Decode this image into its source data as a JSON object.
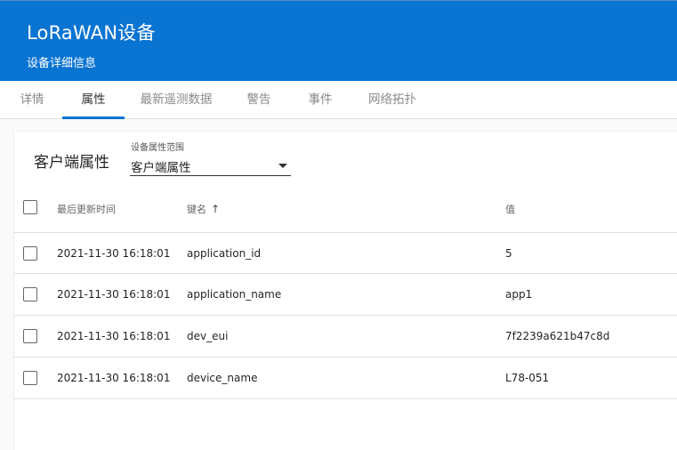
{
  "header": {
    "title": "LoRaWAN设备",
    "subtitle": "设备详细信息"
  },
  "tabs": [
    {
      "label": "详情"
    },
    {
      "label": "属性"
    },
    {
      "label": "最新遥测数据"
    },
    {
      "label": "警告"
    },
    {
      "label": "事件"
    },
    {
      "label": "网络拓扑"
    }
  ],
  "active_tab": "属性",
  "attributes": {
    "title": "客户端属性",
    "scope": {
      "label": "设备属性范围",
      "value": "客户端属性"
    },
    "columns": {
      "last_update": "最后更新时间",
      "key": "键名",
      "value": "值"
    },
    "sort": {
      "column": "key",
      "direction": "ascending",
      "icon": "arrow-up-icon"
    },
    "rows": [
      {
        "last_update": "2021-11-30 16:18:01",
        "key": "application_id",
        "value": "5"
      },
      {
        "last_update": "2021-11-30 16:18:01",
        "key": "application_name",
        "value": "app1"
      },
      {
        "last_update": "2021-11-30 16:18:01",
        "key": "dev_eui",
        "value": "7f2239a621b47c8d"
      },
      {
        "last_update": "2021-11-30 16:18:01",
        "key": "device_name",
        "value": "L78-051"
      }
    ]
  },
  "colors": {
    "header_bg": "#0a74d2",
    "tab_indicator": "#0a74d2"
  }
}
